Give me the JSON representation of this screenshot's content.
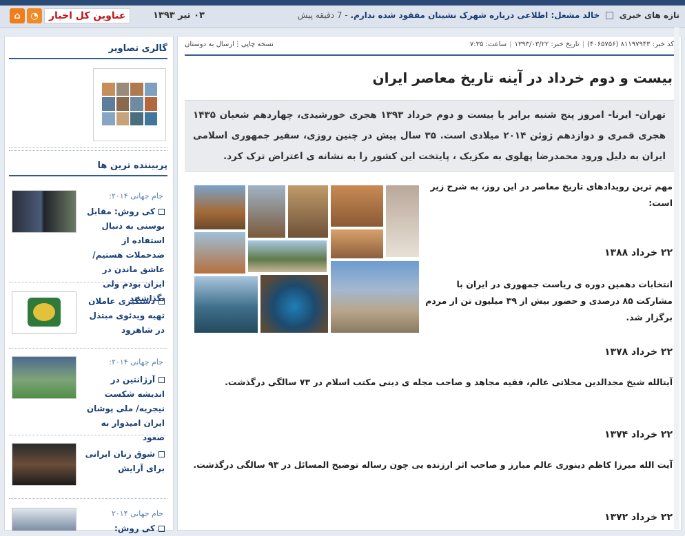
{
  "topbar": {
    "site_title": "عناوین کل اخبار",
    "date": "۰۳ تیر ۱۳۹۳",
    "ticker_label": "تازه های خبری",
    "ticker_item1": "خالد مشعل: اطلاعی درباره شهرک نشینان مفقود شده ندارم.",
    "ticker_time": "- 7 دقیقه پیش",
    "icons": [
      "home-icon",
      "rss-icon"
    ]
  },
  "sidebar": {
    "gallery_title": "گالری تصاویر",
    "popular_title": "پربیننده ترین ها",
    "items": [
      {
        "category": "جام جهانی ۲۰۱۴:",
        "title": "کی روش: مقابل بوسنی به دنبال استفاده از ضدحملات هستیم/عاشق ماندن در ایران بودم ولی نگذاشتند"
      },
      {
        "category": "",
        "title": "دستگیری عاملان تهیه ویدئوی مبتذل در شاهرود"
      },
      {
        "category": "جام جهانی ۲۰۱۴:",
        "title": "آرژانتین در اندیشه شکست نیجریه/ ملی پوشان ایران امیدوار به صعود"
      },
      {
        "category": "",
        "title": "شوق زنان ایرانی برای آرایش"
      },
      {
        "category": "جام جهانی ۲۰۱۴",
        "title": "کی روش:"
      }
    ]
  },
  "article": {
    "meta_code": "کد خبر: ۸۱۱۹۷۹۴۳ (۴۰۶۵۷۵۶)",
    "meta_date": "تاریخ خبر: ۱۳۹۳/۰۳/۲۲",
    "meta_time": "ساعت: ۷:۳۵",
    "print_label": "نسخه چاپی",
    "send_label": "ارسال به دوستان",
    "headline": "بیست و دوم خرداد در آینه تاریخ معاصر ایران",
    "lead": "تهران- ایرنا- امروز پنج شنبه برابر با بیست و دوم خرداد ۱۳۹۳ هجری خورشیدی، چهاردهم شعبان ۱۴۳۵ هجری قمری و دوازدهم ژوئن ۲۰۱۴ میلادی است. ۳۵ سال پیش در چنین روزی، سفیر جمهوری اسلامی ایران به دلیل ورود محمدرضا پهلوی به مکزیک ، پایتخت این کشور را به نشانه ی اعتراض ترک کرد.",
    "intro": "مهم ترین رویدادهای تاریخ معاصر در این روز، به شرح زیر است:",
    "events": [
      {
        "date": "۲۲ خرداد ۱۳۸۸",
        "text": "انتخابات دهمین دوره ی ریاست جمهوری در ایران با مشارکت ۸۵ درصدی و حضور بیش از ۳۹ میلیون تن از مردم برگزار شد."
      },
      {
        "date": "۲۲ خرداد ۱۳۷۸",
        "text": "آیتالله شیخ مجدالدین محلاتی عالم، فقیه مجاهد و صاحب مجله ی دینی مکتب اسلام در ۷۳ سالگی درگذشت."
      },
      {
        "date": "۲۲ خرداد ۱۳۷۴",
        "text": "آیت الله میرزا کاظم دینوری عالم مبارز و صاحب اثر ارزنده یی چون رساله توضیح المسائل در ۹۳ سالگی درگذشت."
      },
      {
        "date": "۲۲ خرداد ۱۳۷۲",
        "text": ""
      }
    ]
  },
  "colors": {
    "accent": "#1a3f78",
    "title_red": "#c4141b",
    "orange": "#f07d1a"
  }
}
